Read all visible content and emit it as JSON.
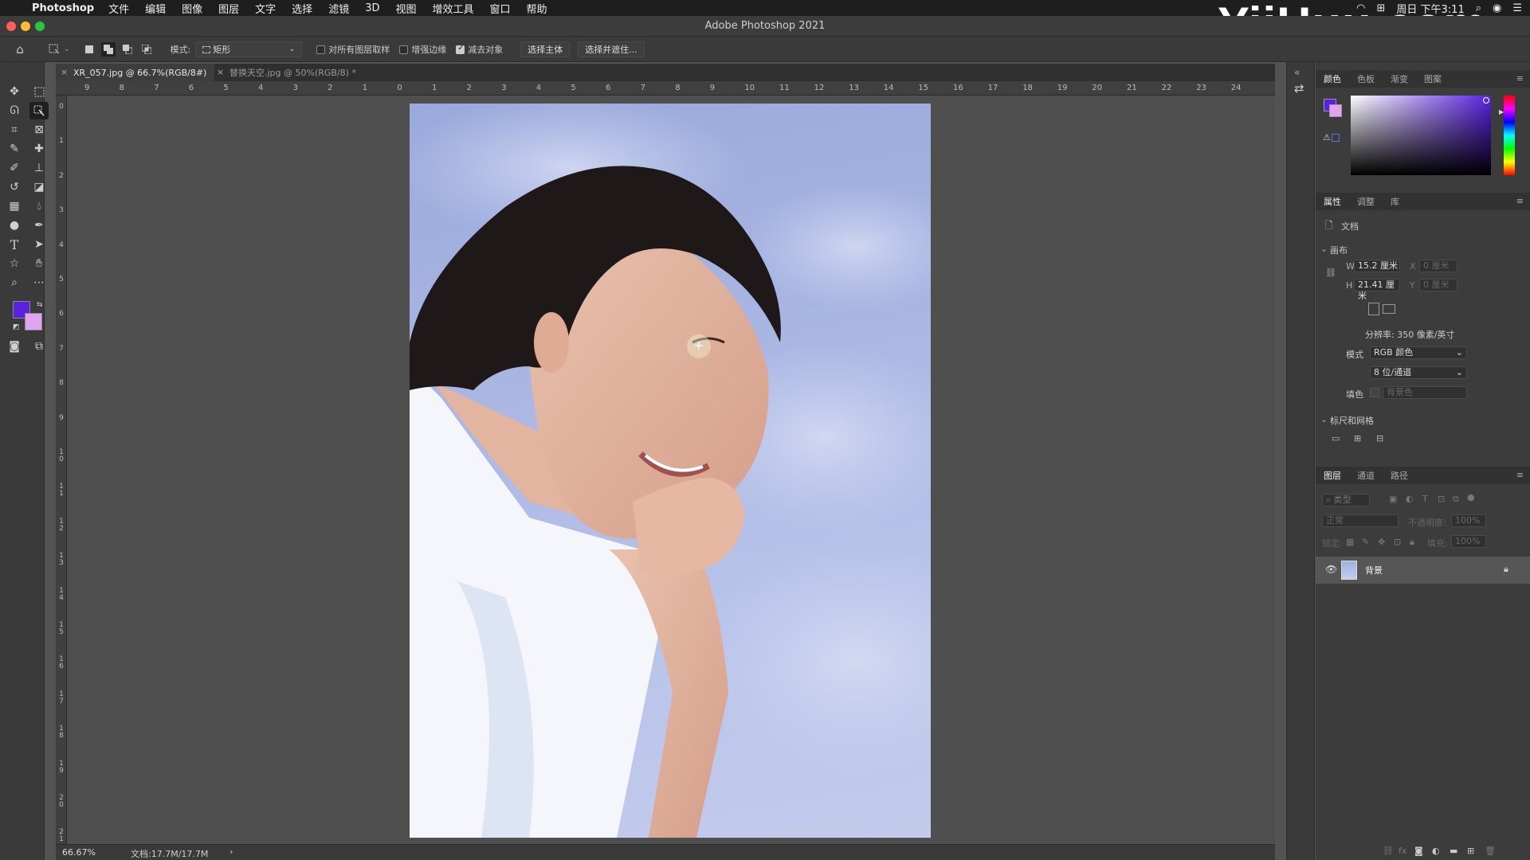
{
  "menubar": {
    "app_name": "Photoshop",
    "items": [
      "文件",
      "编辑",
      "图像",
      "图层",
      "文字",
      "选择",
      "滤镜",
      "3D",
      "视图",
      "增效工具",
      "窗口",
      "帮助"
    ],
    "clock": "周日 下午3:11"
  },
  "watermark": "YiiHuu.com",
  "window": {
    "title": "Adobe Photoshop 2021"
  },
  "options": {
    "mode_label": "模式:",
    "mode_value": "矩形",
    "sample_all_layers": "对所有图层取样",
    "enhance_edge": "增强边缘",
    "subtract_object": "减去对象",
    "select_subject": "选择主体",
    "select_and_mask": "选择并遮住..."
  },
  "tabs": [
    {
      "label": "XR_057.jpg @ 66.7%(RGB/8#)",
      "active": true
    },
    {
      "label": "替换天空.jpg @ 50%(RGB/8) *",
      "active": false
    }
  ],
  "ruler_top": [
    "9",
    "8",
    "7",
    "6",
    "5",
    "4",
    "3",
    "2",
    "1",
    "0",
    "1",
    "2",
    "3",
    "4",
    "5",
    "6",
    "7",
    "8",
    "9",
    "10",
    "11",
    "12",
    "13",
    "14",
    "15",
    "16",
    "17",
    "18",
    "19",
    "20",
    "21",
    "22",
    "23",
    "24"
  ],
  "ruler_left": [
    "0",
    "1",
    "2",
    "3",
    "4",
    "5",
    "6",
    "7",
    "8",
    "9",
    "10",
    "11",
    "12",
    "13",
    "14",
    "15",
    "16",
    "17",
    "18",
    "19",
    "20",
    "21"
  ],
  "status": {
    "zoom": "66.67%",
    "doc": "文档:17.7M/17.7M",
    "arrow": "›"
  },
  "color_panel": {
    "tabs": [
      "颜色",
      "色板",
      "渐变",
      "图案"
    ],
    "foreground": "#5a21e0",
    "background": "#e2a3f0"
  },
  "properties": {
    "tabs": [
      "属性",
      "调整",
      "库"
    ],
    "doc_label": "文档",
    "canvas_section": "画布",
    "w_label": "W",
    "w_value": "15.2 厘米",
    "h_label": "H",
    "h_value": "21.41 厘米",
    "x_label": "X",
    "x_value": "0 厘米",
    "y_label": "Y",
    "y_value": "0 厘米",
    "resolution": "分辨率: 350 像素/英寸",
    "mode_label": "模式",
    "mode_value": "RGB 颜色",
    "depth_value": "8 位/通道",
    "fill_label": "填色",
    "fill_value": "背景色",
    "rulers_section": "标尺和网格"
  },
  "layers": {
    "tabs": [
      "图层",
      "通道",
      "路径"
    ],
    "search_placeholder": "类型",
    "blend_mode": "正常",
    "opacity_label": "不透明度:",
    "opacity_value": "100%",
    "lock_label": "锁定:",
    "fill_label": "填充:",
    "fill_value": "100%",
    "layer_name": "背景"
  }
}
